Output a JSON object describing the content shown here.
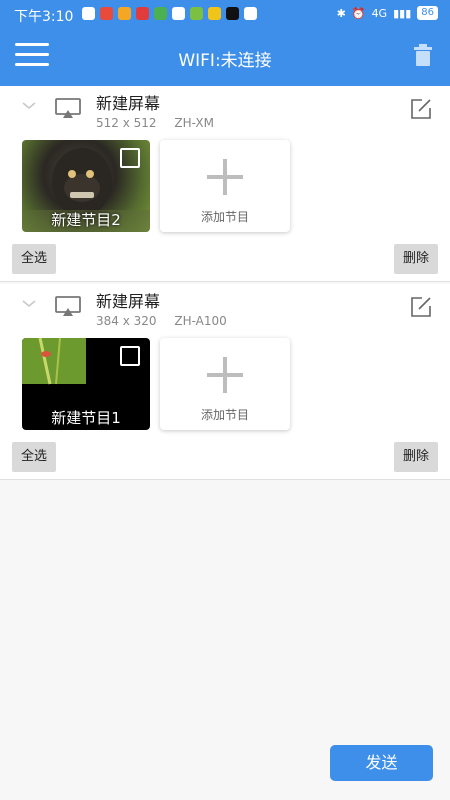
{
  "status_bar": {
    "time": "下午3:10",
    "signal_label": "4G",
    "battery": "86"
  },
  "app_bar": {
    "title": "WIFI:未连接"
  },
  "screens": [
    {
      "name": "新建屏幕",
      "resolution": "512 x 512",
      "model": "ZH-XM",
      "program": {
        "label": "新建节目2"
      },
      "add_label": "添加节目",
      "select_all": "全选",
      "delete": "删除"
    },
    {
      "name": "新建屏幕",
      "resolution": "384 x 320",
      "model": "ZH-A100",
      "program": {
        "label": "新建节目1"
      },
      "add_label": "添加节目",
      "select_all": "全选",
      "delete": "删除"
    }
  ],
  "send_label": "发送",
  "colors": {
    "primary": "#3d8fe9",
    "button_gray": "#d9d9d9"
  }
}
